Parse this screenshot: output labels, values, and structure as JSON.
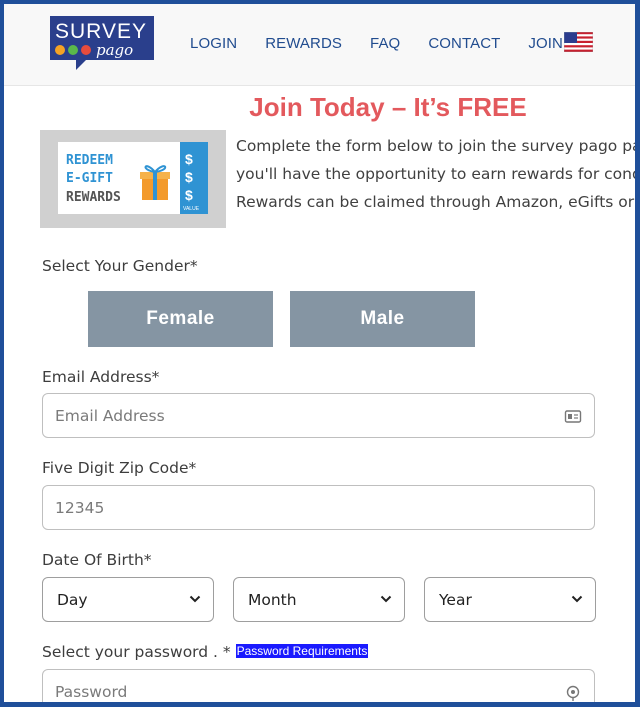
{
  "header": {
    "logo_top": "SURVEY",
    "logo_bottom": "pago",
    "nav": [
      "LOGIN",
      "REWARDS",
      "FAQ",
      "CONTACT",
      "JOIN"
    ],
    "language_flag": "us-flag-icon"
  },
  "hero": {
    "title": "Join Today – It’s FREE",
    "promo_lines": [
      "REDEEM",
      "E-GIFT",
      "REWARDS"
    ],
    "promo_value_label": "VALUE",
    "intro_lines": [
      "Complete the form below to join the survey pago panel. B",
      "you'll have the opportunity to earn rewards for conduct",
      "Rewards can be claimed through Amazon, eGifts or Pay P"
    ]
  },
  "form": {
    "gender_label": "Select Your Gender*",
    "gender_options": [
      "Female",
      "Male"
    ],
    "email_label": "Email Address*",
    "email_placeholder": "Email Address",
    "zip_label": "Five Digit Zip Code*",
    "zip_placeholder": "12345",
    "dob_label": "Date Of Birth*",
    "dob_selects": [
      "Day",
      "Month",
      "Year"
    ],
    "password_label": "Select your password . *",
    "password_link": "Password Requirements",
    "password_placeholder": "Password"
  },
  "colors": {
    "brand_blue": "#214c8f",
    "title_red": "#e3595d",
    "gender_button": "#8595a3",
    "link_highlight": "#1a1aff",
    "frame_border": "#1f4f9a"
  }
}
